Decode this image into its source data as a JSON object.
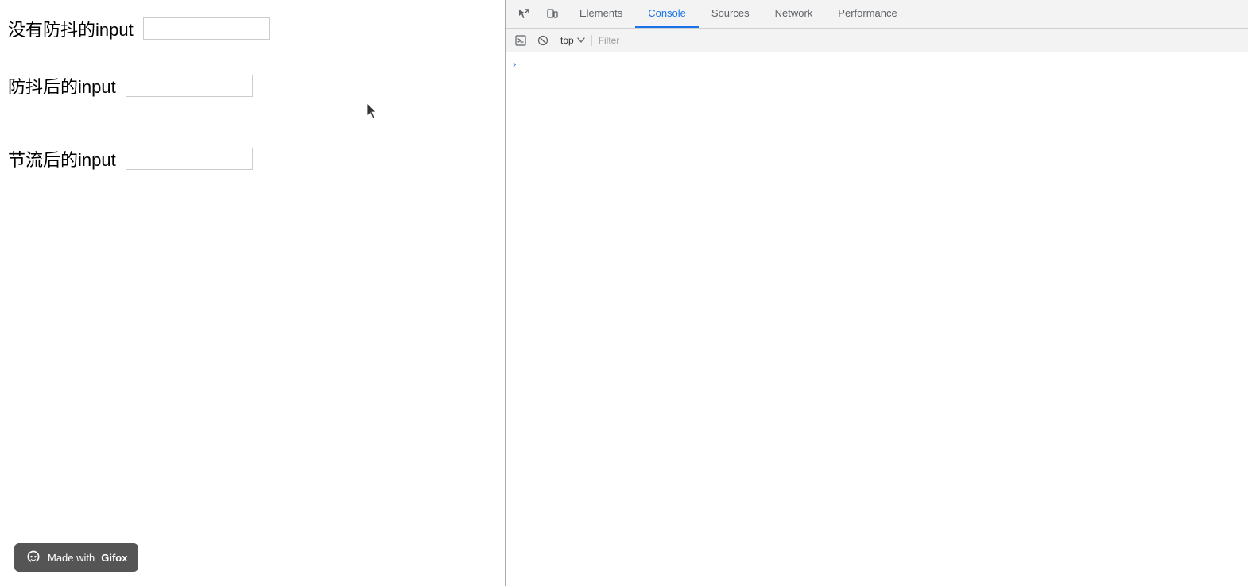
{
  "left": {
    "inputs": [
      {
        "label": "没有防抖的input",
        "id": "no-debounce"
      },
      {
        "label": "防抖后的input",
        "id": "debounce"
      },
      {
        "label": "节流后的input",
        "id": "throttle"
      }
    ],
    "badge": {
      "text": "Made with ",
      "brand": "Gifox"
    }
  },
  "devtools": {
    "tabs": [
      {
        "label": "Elements",
        "active": false
      },
      {
        "label": "Console",
        "active": true
      },
      {
        "label": "Sources",
        "active": false
      },
      {
        "label": "Network",
        "active": false
      },
      {
        "label": "Performance",
        "active": false
      }
    ],
    "context": "top",
    "filter_placeholder": "Filter",
    "chevron": "›"
  }
}
